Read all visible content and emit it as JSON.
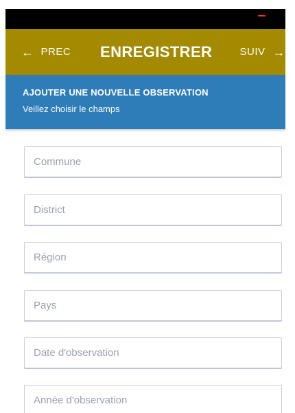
{
  "app_bar": {
    "prev_label": "PREC",
    "title": "ENREGISTRER",
    "next_label": "SUIV",
    "prev_icon": "arrow-left-icon",
    "next_icon": "arrow-right-icon",
    "background": "#a48a00"
  },
  "header": {
    "title": "AJOUTER UNE NOUVELLE OBSERVATION",
    "subtitle": "Veillez choisir le champs",
    "background": "#2e7cb8"
  },
  "form": {
    "fields": [
      {
        "placeholder": "Commune",
        "value": ""
      },
      {
        "placeholder": "District",
        "value": ""
      },
      {
        "placeholder": "Région",
        "value": ""
      },
      {
        "placeholder": "Pays",
        "value": ""
      },
      {
        "placeholder": "Date d'observation",
        "value": ""
      },
      {
        "placeholder": "Année d'observation",
        "value": ""
      }
    ]
  },
  "colors": {
    "status_bar": "#000000",
    "status_indicator": "#e5322b"
  }
}
